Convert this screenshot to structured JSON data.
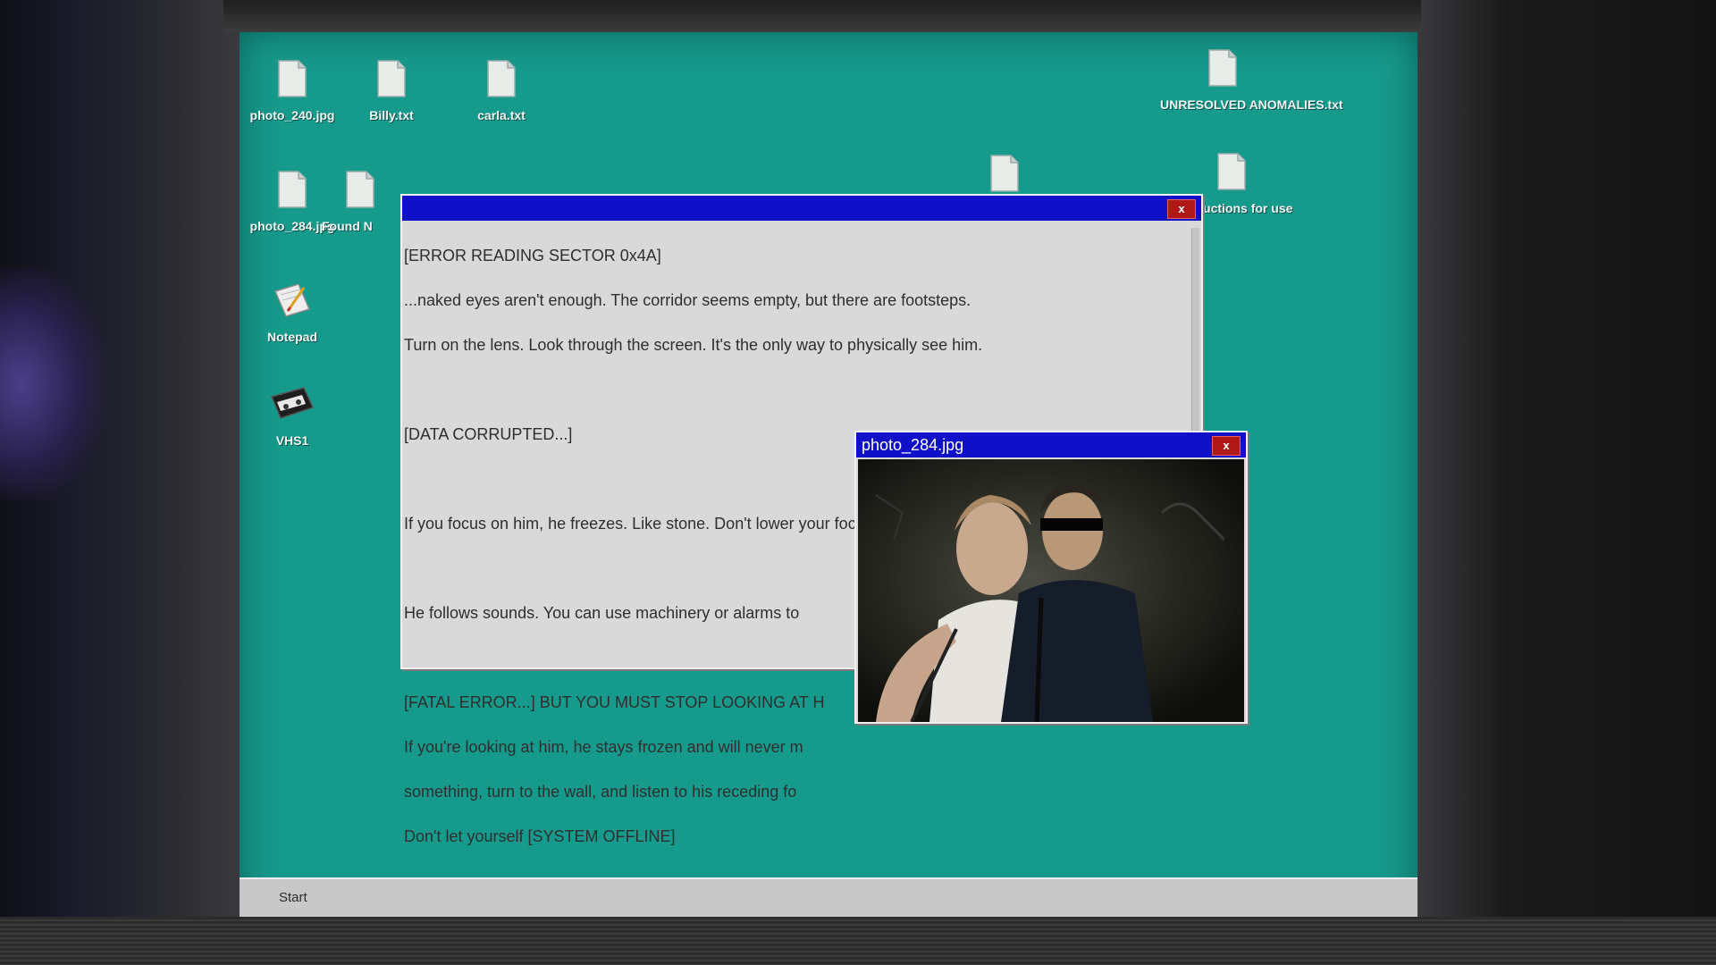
{
  "desktop": {
    "background_color": "#169a8c",
    "icons": [
      {
        "label": "photo_240.jpg",
        "icon": "file-icon"
      },
      {
        "label": "Billy.txt",
        "icon": "file-icon"
      },
      {
        "label": "carla.txt",
        "icon": "file-icon"
      },
      {
        "label": "UNRESOLVED ANOMALIES.txt",
        "icon": "file-icon"
      },
      {
        "label": "photo_284.jpg",
        "icon": "file-icon"
      },
      {
        "label": "Found N",
        "icon": "file-icon"
      },
      {
        "label": "",
        "icon": "file-icon"
      },
      {
        "label": "nstructions for use",
        "icon": "file-icon"
      },
      {
        "label": "Notepad",
        "icon": "notepad-icon"
      },
      {
        "label": "VHS1",
        "icon": "vhs-tape-icon"
      }
    ]
  },
  "text_window": {
    "close_label": "x",
    "lines": {
      "header": "[ERROR READING SECTOR 0x4A]",
      "p1a": "...naked eyes aren't enough. The corridor seems empty, but there are footsteps.",
      "p1b": "Turn on the lens. Look through the screen. It's the only way to physically see him.",
      "corrupt": "[DATA CORRUPTED...]",
      "p2": "If you focus on him, he freezes. Like stone. Don't lower your focus; if you lose eye contact, he'll jump on you.",
      "p3": "He follows sounds. You can use machinery or alarms to",
      "fatal": "[FATAL ERROR...] BUT YOU MUST STOP LOOKING AT H",
      "p4a": "If you're looking at him, he stays frozen and will never m",
      "p4b": "something, turn to the wall, and listen to his receding fo",
      "p4c": "Don't let yourself [SYSTEM OFFLINE]"
    }
  },
  "photo_window": {
    "title": "photo_284.jpg",
    "close_label": "x"
  },
  "taskbar": {
    "start_label": "Start"
  },
  "colors": {
    "titlebar": "#1010c8",
    "close": "#b01818",
    "window_bg": "#d9d9d9"
  }
}
